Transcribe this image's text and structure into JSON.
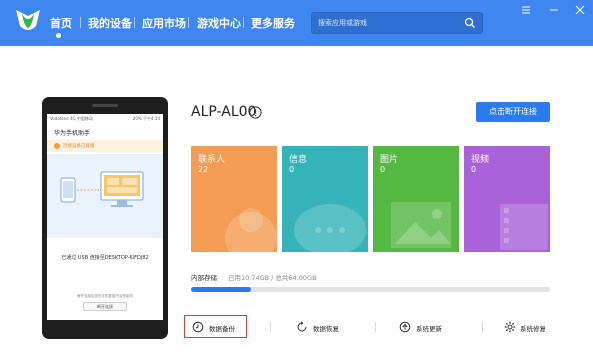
{
  "header": {
    "nav": [
      {
        "label": "首页"
      },
      {
        "label": "我的设备"
      },
      {
        "label": "应用市场"
      },
      {
        "label": "游戏中心"
      },
      {
        "label": "更多服务"
      }
    ],
    "search_placeholder": "搜索应用或游戏",
    "colors": {
      "bar": "#3f86f0",
      "search": "#2f6fd0"
    }
  },
  "phone": {
    "status_left": "Vodafone 4G 中国移动",
    "status_right": "20% 下午4:14",
    "app_title": "华为手机助手",
    "notice": "连接设备已就绪",
    "usb_text": "已通过 USB 连接至DESKTOP-6IFDJ82",
    "footer_text": "断开连接后您的手机数据不会受影响",
    "button": "断开连接"
  },
  "device": {
    "name": "ALP-AL00",
    "disconnect_button": "点击断开连接",
    "tiles": [
      {
        "label": "联系人",
        "count": "22",
        "color": "#f39c53"
      },
      {
        "label": "信息",
        "count": "0",
        "color": "#35b3b8"
      },
      {
        "label": "图片",
        "count": "0",
        "color": "#55b843"
      },
      {
        "label": "视频",
        "count": "0",
        "color": "#a962d8"
      }
    ],
    "storage": {
      "label": "内部存储",
      "value": "已用10.74GB / 总共64.00GB",
      "used_fraction": 0.168
    }
  },
  "actions": [
    {
      "label": "数据备份",
      "icon": "clock-icon"
    },
    {
      "label": "数据恢复",
      "icon": "refresh-icon"
    },
    {
      "label": "系统更新",
      "icon": "upload-icon"
    },
    {
      "label": "系统修复",
      "icon": "gear-icon"
    }
  ]
}
